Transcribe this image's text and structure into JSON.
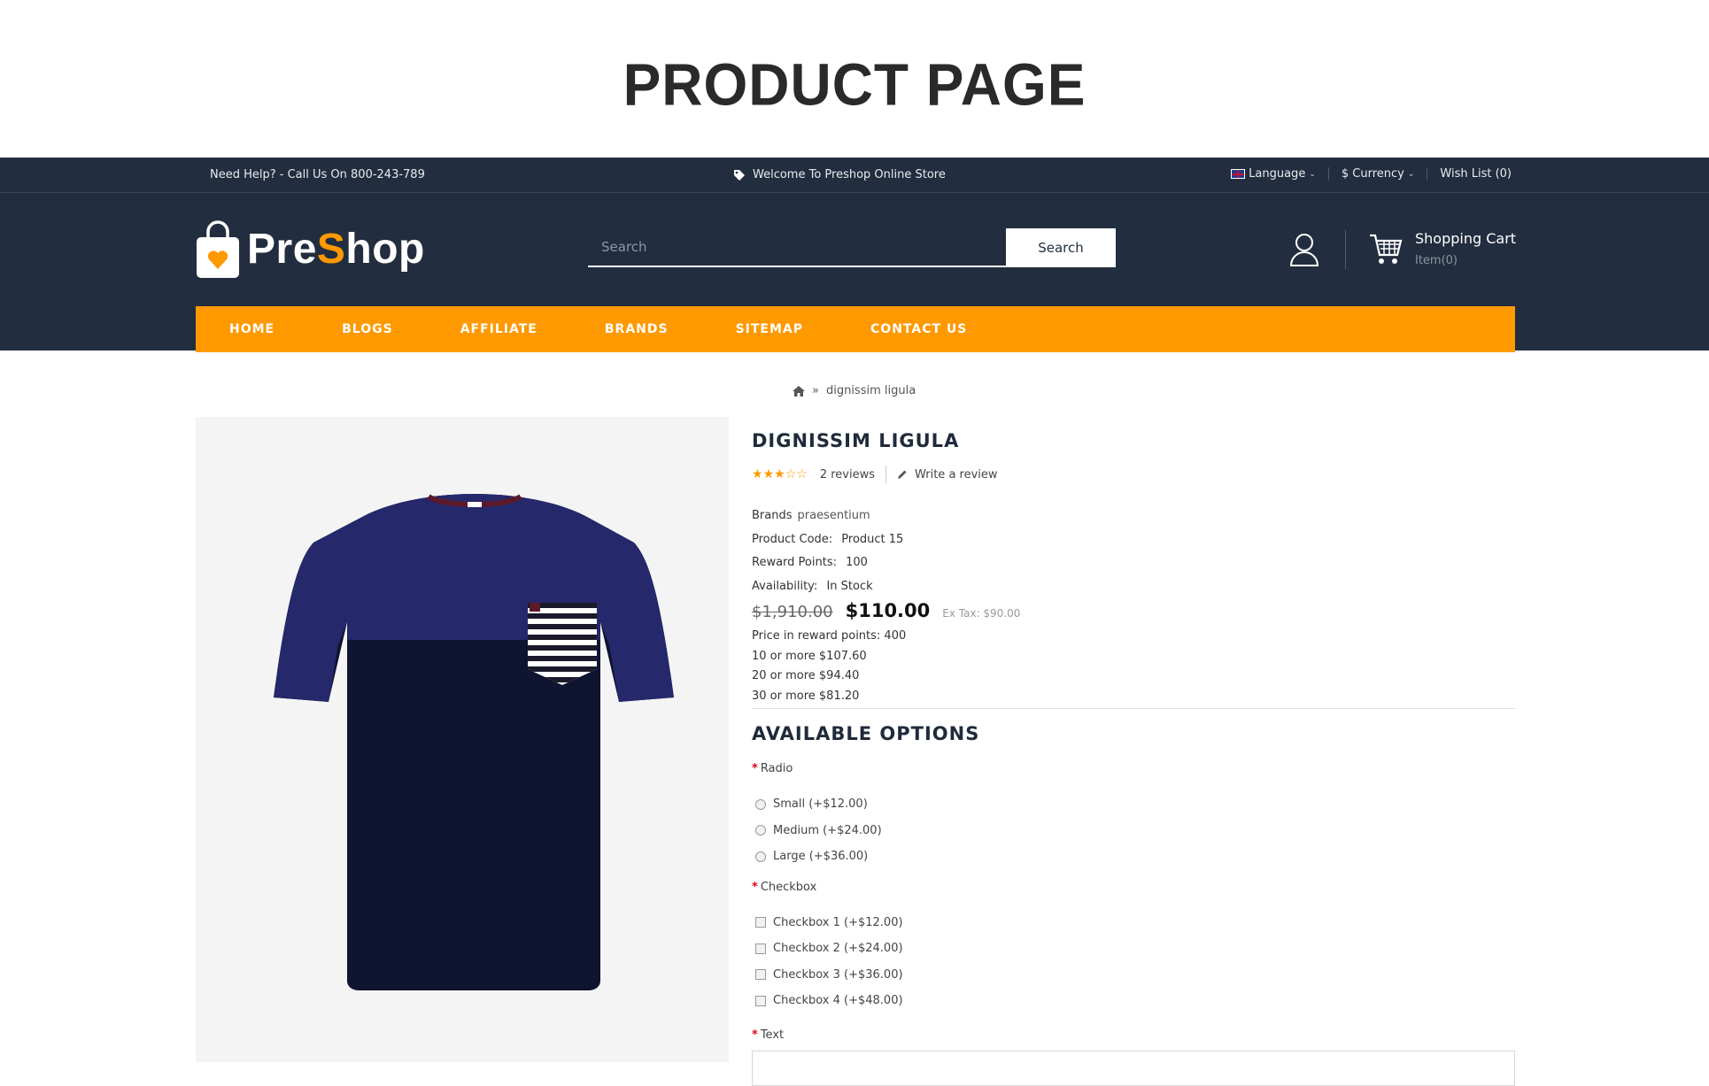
{
  "hero": {
    "title": "PRODUCT PAGE"
  },
  "topbar": {
    "help": "Need Help? - Call Us On 800-243-789",
    "welcome": "Welcome To Preshop Online Store",
    "language": "Language",
    "currency": "$ Currency",
    "wishlist": "Wish List (0)"
  },
  "header": {
    "logo_pre": "Pre",
    "logo_s": "S",
    "logo_hop": "hop",
    "search_placeholder": "Search",
    "search_button": "Search",
    "cart_title": "Shopping Cart",
    "cart_items": "Item(0)"
  },
  "nav": {
    "items": [
      "HOME",
      "BLOGS",
      "AFFILIATE",
      "BRANDS",
      "SITEMAP",
      "CONTACT US"
    ]
  },
  "breadcrumb": {
    "separator": "»",
    "current": "dignissim ligula"
  },
  "product": {
    "title": "DIGNISSIM LIGULA",
    "rating": 3,
    "rating_max": 5,
    "reviews": "2 reviews",
    "write_review": "Write a review",
    "brand_label": "Brands",
    "brand_value": "praesentium",
    "code_label": "Product Code:",
    "code_value": "Product 15",
    "points_label": "Reward Points:",
    "points_value": "100",
    "avail_label": "Availability:",
    "avail_value": "In Stock",
    "old_price": "$1,910.00",
    "price": "$110.00",
    "ex_tax": "Ex Tax: $90.00",
    "reward_price": "Price in reward points: 400",
    "discounts": [
      "10 or more $107.60",
      "20 or more $94.40",
      "30 or more $81.20"
    ]
  },
  "options": {
    "title": "AVAILABLE OPTIONS",
    "radio_label": "Radio",
    "radio_items": [
      "Small (+$12.00)",
      "Medium (+$24.00)",
      "Large (+$36.00)"
    ],
    "checkbox_label": "Checkbox",
    "checkbox_items": [
      "Checkbox 1 (+$12.00)",
      "Checkbox 2 (+$24.00)",
      "Checkbox 3 (+$36.00)",
      "Checkbox 4 (+$48.00)"
    ],
    "text_label": "Text",
    "required_mark": "*"
  },
  "colors": {
    "header_bg": "#222e3f",
    "accent": "#ff9900",
    "required": "#e3001b"
  }
}
